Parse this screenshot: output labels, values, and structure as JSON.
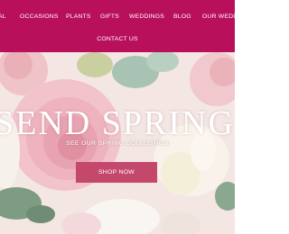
{
  "nav": {
    "items": [
      {
        "label": "AL"
      },
      {
        "label": "OCCASIONS"
      },
      {
        "label": "PLANTS"
      },
      {
        "label": "GIFTS"
      },
      {
        "label": "WEDDINGS"
      },
      {
        "label": "BLOG"
      },
      {
        "label": "OUR WEDDI"
      }
    ],
    "contact_label": "CONTACT US"
  },
  "hero": {
    "title": "SEND SPRING",
    "subtitle": "SEE OUR SPRING COLLECTION",
    "button_label": "SHOP NOW",
    "image_icon": "flower-bouquet-photo"
  },
  "colors": {
    "nav_background": "#b8105a",
    "button_background": "#c4476c",
    "text_on_brand": "#ffffff"
  }
}
